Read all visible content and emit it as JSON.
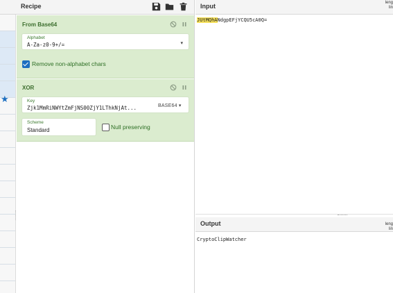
{
  "recipe": {
    "title": "Recipe",
    "toolbar": {
      "save_icon": "save-icon",
      "load_icon": "folder-icon",
      "clear_icon": "trash-icon"
    },
    "operations": [
      {
        "name": "From Base64",
        "alphabet": {
          "label": "Alphabet",
          "value": "A-Za-z0-9+/="
        },
        "remove_non_alphabet": {
          "label": "Remove non-alphabet chars",
          "checked": true
        }
      },
      {
        "name": "XOR",
        "key": {
          "label": "Key",
          "value": "Zjk1MmRiNWYtZmFjNS00ZjY1LThkNjAt...",
          "encoding": "BASE64"
        },
        "scheme": {
          "label": "Scheme",
          "value": "Standard"
        },
        "null_preserving": {
          "label": "Null preserving",
          "checked": false
        }
      }
    ]
  },
  "input": {
    "title": "Input",
    "meta_line1": "leng",
    "meta_line2": "lin",
    "highlighted": "JUtMQhA",
    "rest": "NdgpEFjYCQU5cA0Q="
  },
  "output": {
    "title": "Output",
    "meta_line1": "leng",
    "meta_line2": "lin",
    "text": "CryptoClipWatcher"
  },
  "colors": {
    "operation_bg": "#dbeccf",
    "checkbox_accent": "#1d6fc0",
    "highlight": "#f5e05a"
  }
}
